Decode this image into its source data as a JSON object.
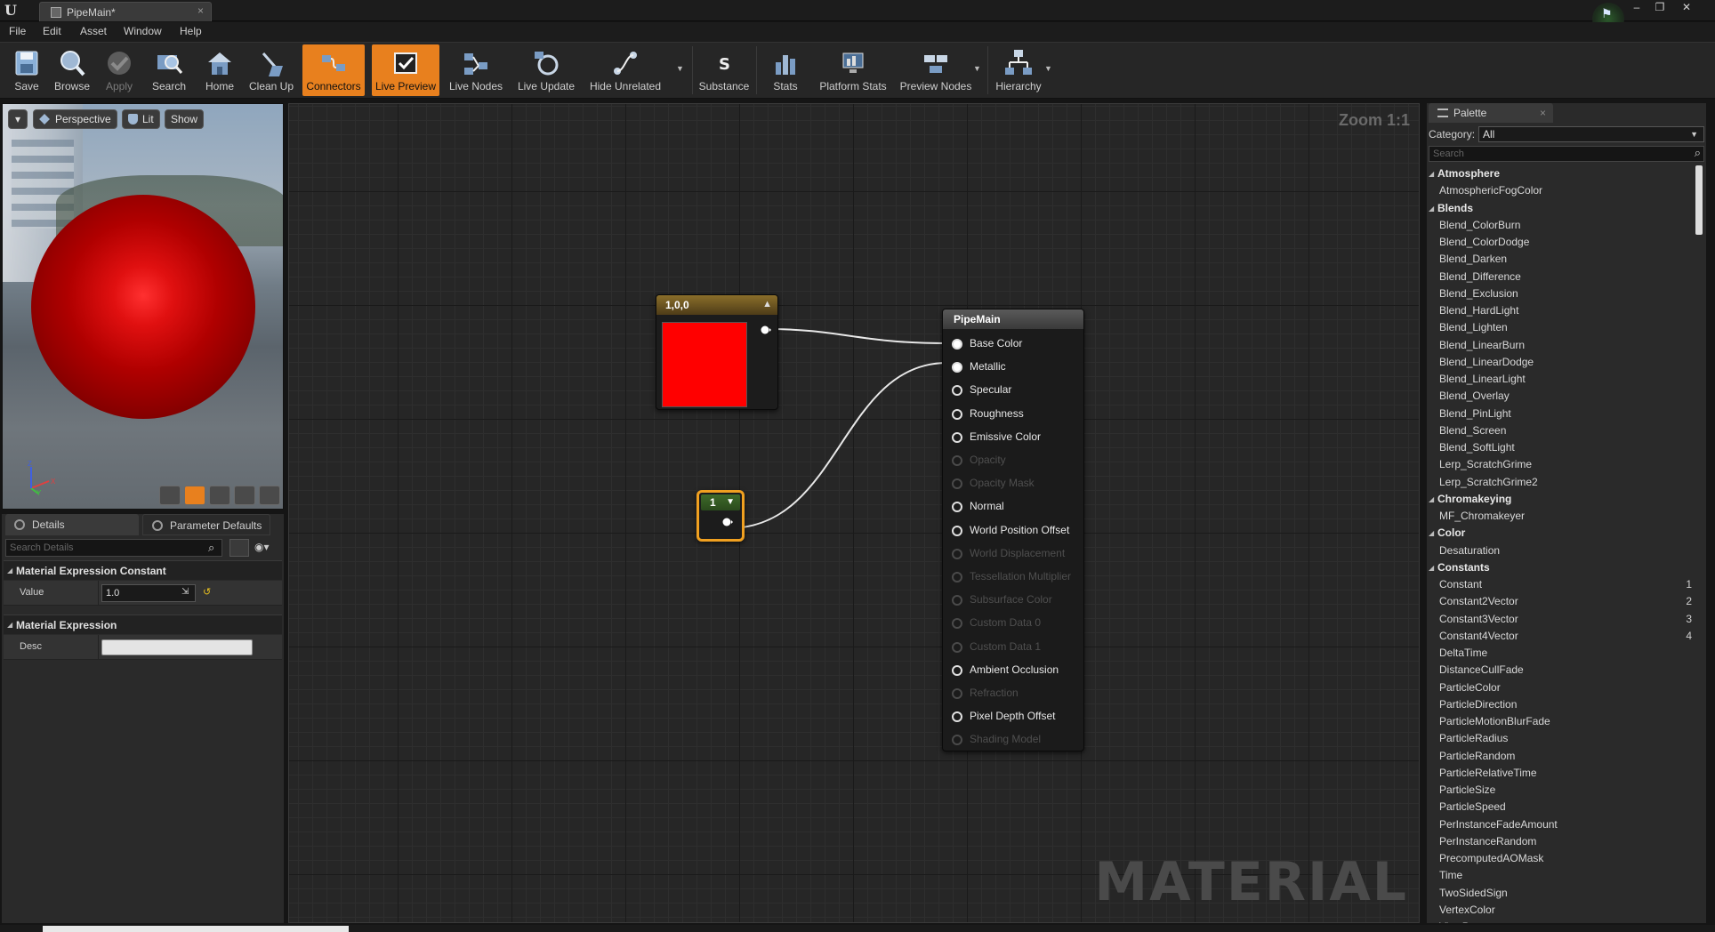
{
  "window": {
    "title": "PipeMain*",
    "app_logo": "UE",
    "close_tab": "×",
    "controls": {
      "minimize": "–",
      "restore": "❐",
      "close": "✕"
    }
  },
  "menu": [
    "File",
    "Edit",
    "Asset",
    "Window",
    "Help"
  ],
  "toolbar": {
    "buttons": [
      {
        "label": "Save",
        "icon": "save-icon",
        "state": "normal"
      },
      {
        "label": "Browse",
        "icon": "browse-icon",
        "state": "normal"
      },
      {
        "label": "Apply",
        "icon": "apply-icon",
        "state": "disabled"
      },
      {
        "label": "Search",
        "icon": "search-icon",
        "state": "normal"
      },
      {
        "label": "Home",
        "icon": "home-icon",
        "state": "normal"
      },
      {
        "label": "Clean Up",
        "icon": "clean-up-icon",
        "state": "normal"
      },
      {
        "label": "Connectors",
        "icon": "connectors-icon",
        "state": "active"
      },
      {
        "label": "Live Preview",
        "icon": "live-preview-icon",
        "state": "active"
      },
      {
        "label": "Live Nodes",
        "icon": "live-nodes-icon",
        "state": "normal"
      },
      {
        "label": "Live Update",
        "icon": "live-update-icon",
        "state": "normal"
      },
      {
        "label": "Hide Unrelated",
        "icon": "hide-unrelated-icon",
        "state": "normal"
      },
      {
        "label": "Substance",
        "icon": "substance-icon",
        "state": "normal"
      },
      {
        "label": "Stats",
        "icon": "stats-icon",
        "state": "normal"
      },
      {
        "label": "Platform Stats",
        "icon": "platform-stats-icon",
        "state": "normal"
      },
      {
        "label": "Preview Nodes",
        "icon": "preview-nodes-icon",
        "state": "normal"
      },
      {
        "label": "Hierarchy",
        "icon": "hierarchy-icon",
        "state": "normal"
      }
    ]
  },
  "viewport": {
    "view_mode": "Perspective",
    "lighting": "Lit",
    "show": "Show",
    "axis": {
      "x": "X",
      "y": "Y",
      "z": "Z"
    },
    "sphere_color": "#d01010"
  },
  "details": {
    "tabs": [
      "Details",
      "Parameter Defaults"
    ],
    "search_placeholder": "Search Details",
    "sections": [
      {
        "title": "Material Expression Constant",
        "rows": [
          {
            "label": "Value",
            "value": "1.0"
          }
        ]
      },
      {
        "title": "Material Expression",
        "rows": [
          {
            "label": "Desc",
            "value": ""
          }
        ]
      }
    ]
  },
  "graph": {
    "zoom": "Zoom 1:1",
    "watermark": "MATERIAL",
    "color_node": {
      "title": "1,0,0",
      "color": "#ff0000"
    },
    "constant_node": {
      "title": "1"
    },
    "main_node": {
      "title": "PipeMain",
      "pins": [
        {
          "label": "Base Color",
          "enabled": true,
          "connected": true
        },
        {
          "label": "Metallic",
          "enabled": true,
          "connected": true
        },
        {
          "label": "Specular",
          "enabled": true,
          "connected": false
        },
        {
          "label": "Roughness",
          "enabled": true,
          "connected": false
        },
        {
          "label": "Emissive Color",
          "enabled": true,
          "connected": false
        },
        {
          "label": "Opacity",
          "enabled": false,
          "connected": false
        },
        {
          "label": "Opacity Mask",
          "enabled": false,
          "connected": false
        },
        {
          "label": "Normal",
          "enabled": true,
          "connected": false
        },
        {
          "label": "World Position Offset",
          "enabled": true,
          "connected": false
        },
        {
          "label": "World Displacement",
          "enabled": false,
          "connected": false
        },
        {
          "label": "Tessellation Multiplier",
          "enabled": false,
          "connected": false
        },
        {
          "label": "Subsurface Color",
          "enabled": false,
          "connected": false
        },
        {
          "label": "Custom Data 0",
          "enabled": false,
          "connected": false
        },
        {
          "label": "Custom Data 1",
          "enabled": false,
          "connected": false
        },
        {
          "label": "Ambient Occlusion",
          "enabled": true,
          "connected": false
        },
        {
          "label": "Refraction",
          "enabled": false,
          "connected": false
        },
        {
          "label": "Pixel Depth Offset",
          "enabled": true,
          "connected": false
        },
        {
          "label": "Shading Model",
          "enabled": false,
          "connected": false
        }
      ]
    }
  },
  "palette": {
    "tab": "Palette",
    "category_label": "Category:",
    "category_value": "All",
    "search_placeholder": "Search",
    "items": [
      {
        "type": "cat",
        "label": "Atmosphere"
      },
      {
        "type": "leaf",
        "label": "AtmosphericFogColor"
      },
      {
        "type": "cat",
        "label": "Blends"
      },
      {
        "type": "leaf",
        "label": "Blend_ColorBurn"
      },
      {
        "type": "leaf",
        "label": "Blend_ColorDodge"
      },
      {
        "type": "leaf",
        "label": "Blend_Darken"
      },
      {
        "type": "leaf",
        "label": "Blend_Difference"
      },
      {
        "type": "leaf",
        "label": "Blend_Exclusion"
      },
      {
        "type": "leaf",
        "label": "Blend_HardLight"
      },
      {
        "type": "leaf",
        "label": "Blend_Lighten"
      },
      {
        "type": "leaf",
        "label": "Blend_LinearBurn"
      },
      {
        "type": "leaf",
        "label": "Blend_LinearDodge"
      },
      {
        "type": "leaf",
        "label": "Blend_LinearLight"
      },
      {
        "type": "leaf",
        "label": "Blend_Overlay"
      },
      {
        "type": "leaf",
        "label": "Blend_PinLight"
      },
      {
        "type": "leaf",
        "label": "Blend_Screen"
      },
      {
        "type": "leaf",
        "label": "Blend_SoftLight"
      },
      {
        "type": "leaf",
        "label": "Lerp_ScratchGrime"
      },
      {
        "type": "leaf",
        "label": "Lerp_ScratchGrime2"
      },
      {
        "type": "cat",
        "label": "Chromakeying"
      },
      {
        "type": "leaf",
        "label": "MF_Chromakeyer"
      },
      {
        "type": "cat",
        "label": "Color"
      },
      {
        "type": "leaf",
        "label": "Desaturation"
      },
      {
        "type": "cat",
        "label": "Constants"
      },
      {
        "type": "leaf",
        "label": "Constant",
        "hotkey": "1"
      },
      {
        "type": "leaf",
        "label": "Constant2Vector",
        "hotkey": "2"
      },
      {
        "type": "leaf",
        "label": "Constant3Vector",
        "hotkey": "3"
      },
      {
        "type": "leaf",
        "label": "Constant4Vector",
        "hotkey": "4"
      },
      {
        "type": "leaf",
        "label": "DeltaTime"
      },
      {
        "type": "leaf",
        "label": "DistanceCullFade"
      },
      {
        "type": "leaf",
        "label": "ParticleColor"
      },
      {
        "type": "leaf",
        "label": "ParticleDirection"
      },
      {
        "type": "leaf",
        "label": "ParticleMotionBlurFade"
      },
      {
        "type": "leaf",
        "label": "ParticleRadius"
      },
      {
        "type": "leaf",
        "label": "ParticleRandom"
      },
      {
        "type": "leaf",
        "label": "ParticleRelativeTime"
      },
      {
        "type": "leaf",
        "label": "ParticleSize"
      },
      {
        "type": "leaf",
        "label": "ParticleSpeed"
      },
      {
        "type": "leaf",
        "label": "PerInstanceFadeAmount"
      },
      {
        "type": "leaf",
        "label": "PerInstanceRandom"
      },
      {
        "type": "leaf",
        "label": "PrecomputedAOMask"
      },
      {
        "type": "leaf",
        "label": "Time"
      },
      {
        "type": "leaf",
        "label": "TwoSidedSign"
      },
      {
        "type": "leaf",
        "label": "VertexColor"
      },
      {
        "type": "leaf",
        "label": "ViewProperty"
      }
    ]
  }
}
